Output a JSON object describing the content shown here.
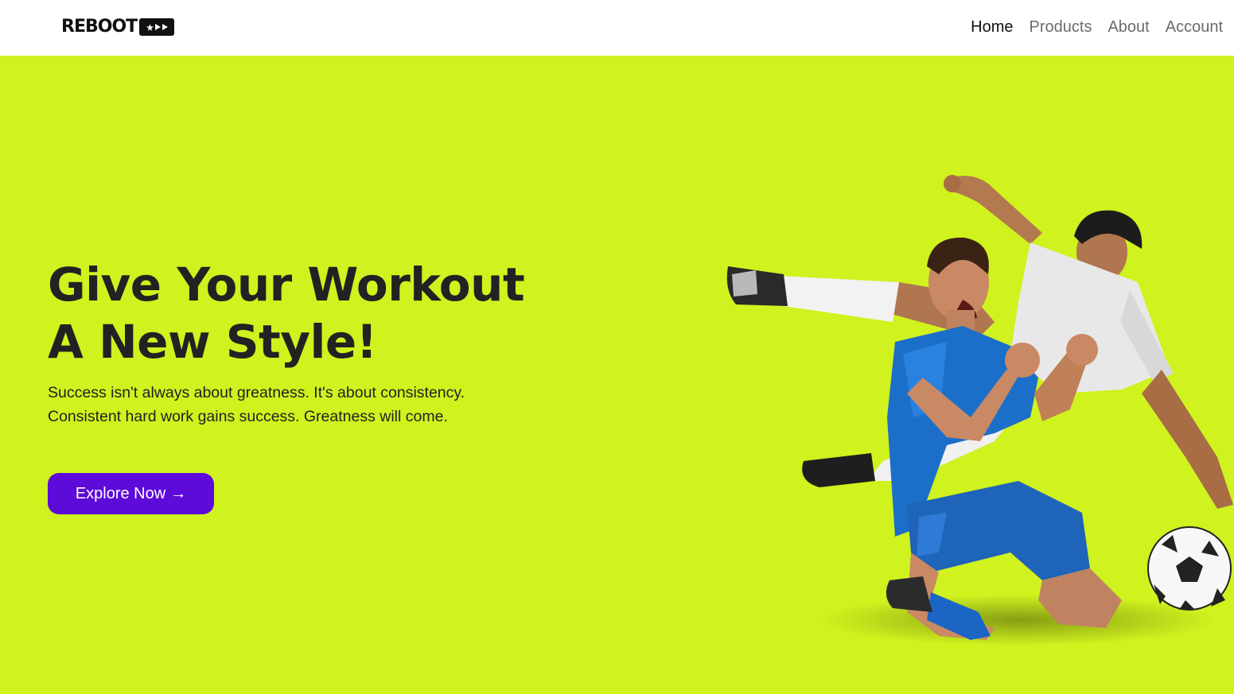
{
  "colors": {
    "hero_background": "#d0f21e",
    "navbar_background": "#ffffff",
    "cta_background": "#5d0bd9",
    "text_dark": "#222222",
    "nav_inactive": "#6b6b6b"
  },
  "header": {
    "logo_text": "REBOOT",
    "logo_badge_icons": [
      "star-icon",
      "play-icon",
      "play-icon"
    ],
    "nav": [
      {
        "label": "Home",
        "active": true
      },
      {
        "label": "Products",
        "active": false
      },
      {
        "label": "About",
        "active": false
      },
      {
        "label": "Account",
        "active": false
      }
    ]
  },
  "hero": {
    "title_line1": "Give Your Workout",
    "title_line2": "A New Style!",
    "subtitle_line1": "Success isn't always about greatness. It's about consistency.",
    "subtitle_line2": "Consistent hard work gains success. Greatness will come.",
    "cta_label": "Explore Now",
    "cta_icon": "→",
    "image_icon": "soccer-players-image"
  }
}
